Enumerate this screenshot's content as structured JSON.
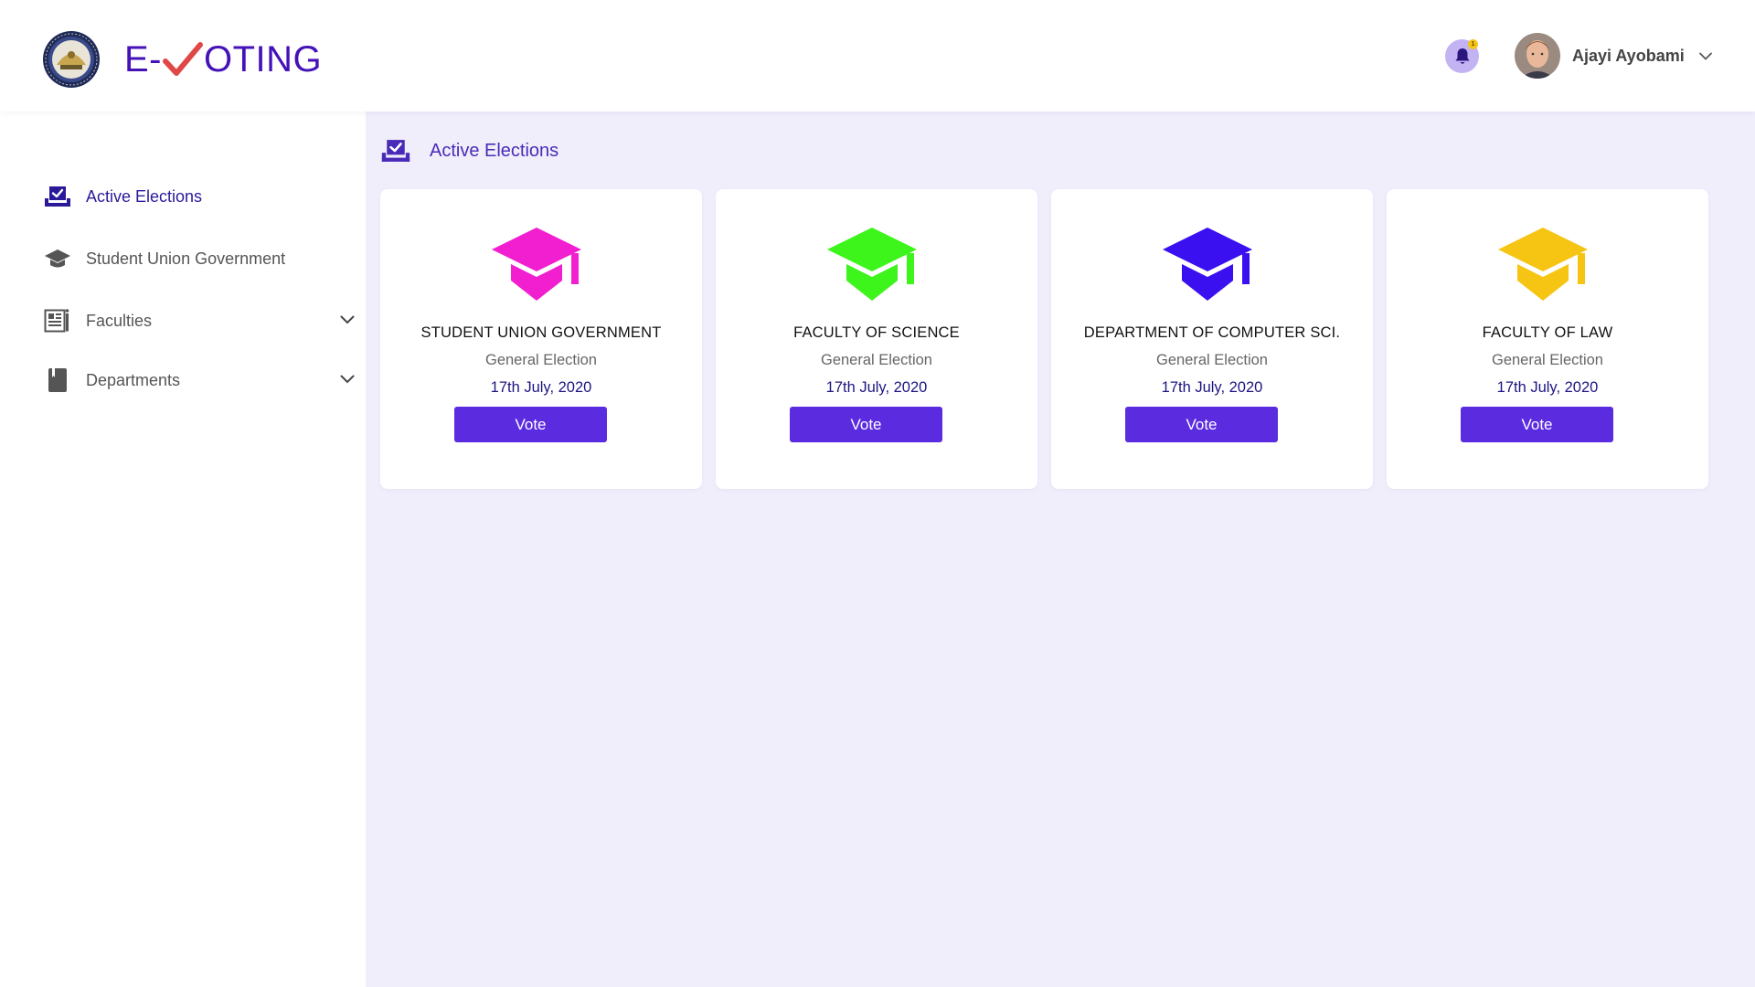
{
  "header": {
    "brand_prefix": "E-",
    "brand_suffix": "OTING",
    "notification_count": "1",
    "user_name": "Ajayi Ayobami",
    "icons": {
      "bell": "bell-icon",
      "chevron": "chevron-down-icon",
      "logo": "university-seal-icon"
    }
  },
  "sidebar": {
    "items": [
      {
        "label": "Active Elections",
        "icon": "ballot-box-icon",
        "active": true
      },
      {
        "label": "Student Union Government",
        "icon": "graduation-cap-icon"
      },
      {
        "label": "Faculties",
        "icon": "newspaper-icon",
        "expandable": true
      },
      {
        "label": "Departments",
        "icon": "book-icon",
        "expandable": true
      }
    ]
  },
  "main": {
    "section_title": "Active Elections",
    "cards": [
      {
        "title": "STUDENT UNION GOVERNMENT",
        "type": "General Election",
        "date": "17th July, 2020",
        "button": "Vote",
        "color": "#f11fd0"
      },
      {
        "title": "FACULTY OF SCIENCE",
        "type": "General Election",
        "date": "17th July, 2020",
        "button": "Vote",
        "color": "#3df51a"
      },
      {
        "title": "DEPARTMENT OF COMPUTER SCI.",
        "type": "General Election",
        "date": "17th July, 2020",
        "button": "Vote",
        "color": "#3a0ff0"
      },
      {
        "title": "FACULTY OF LAW",
        "type": "General Election",
        "date": "17th July, 2020",
        "button": "Vote",
        "color": "#f6c514"
      }
    ]
  },
  "colors": {
    "accent": "#5b2be0",
    "brand": "#4512b8",
    "tick": "#e04848",
    "main_bg": "#f0eefb"
  }
}
